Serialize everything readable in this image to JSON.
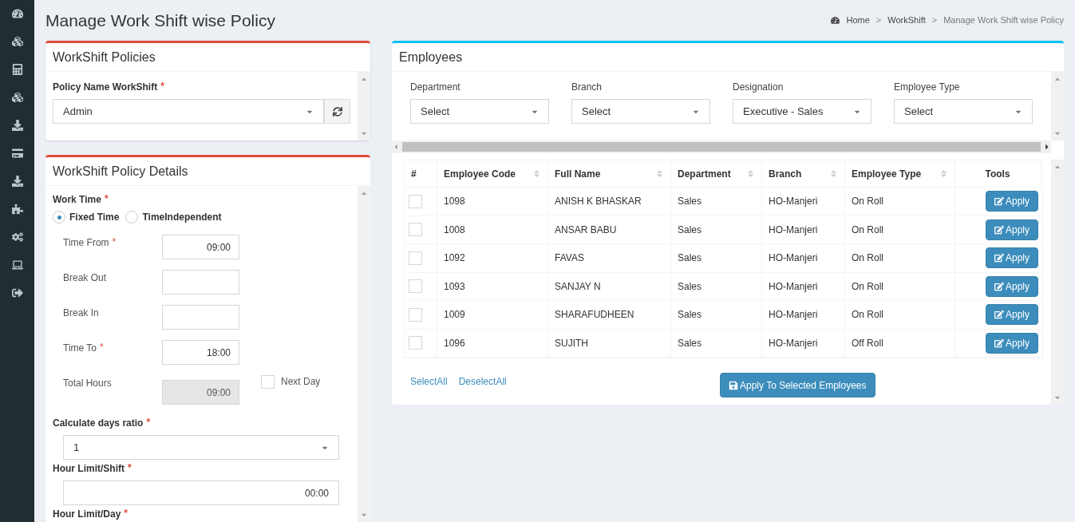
{
  "page_title": "Manage Work Shift wise Policy",
  "breadcrumb": [
    {
      "label": "Home",
      "separator": ">"
    },
    {
      "label": "WorkShift",
      "separator": ">"
    },
    {
      "label": "Manage Work Shift wise Policy"
    }
  ],
  "policies_panel": {
    "title": "WorkShift Policies",
    "field": {
      "label": "Policy Name WorkShift",
      "required_mark": "*",
      "value": "Admin"
    }
  },
  "details_panel": {
    "title": "WorkShift Policy Details",
    "work_time": {
      "label": "Work Time",
      "required_mark": "*",
      "options": [
        {
          "label": "Fixed Time",
          "selected": true
        },
        {
          "label": "TimeIndependent",
          "selected": false
        }
      ]
    },
    "time_fields": [
      {
        "label": "Time From",
        "required_mark": "*",
        "value": "09:00",
        "disabled": false
      },
      {
        "label": "Break Out",
        "disabled": false
      },
      {
        "label": "Break In",
        "disabled": false
      },
      {
        "label": "Time To",
        "required_mark": "*",
        "value": "18:00",
        "disabled": false
      },
      {
        "label": "Total Hours",
        "value": "09:00",
        "disabled": true
      }
    ],
    "next_day": {
      "label": "Next Day",
      "checked": false
    },
    "days_ratio": {
      "label": "Calculate days ratio",
      "required_mark": "*",
      "value": "1"
    },
    "hour_limit_shift": {
      "label": "Hour Limit/Shift",
      "required_mark": "*",
      "value": "00:00"
    },
    "hour_limit_day": {
      "label": "Hour Limit/Day",
      "required_mark": "*"
    }
  },
  "employees_panel": {
    "title": "Employees",
    "filters": [
      {
        "label": "Department",
        "value": "Select"
      },
      {
        "label": "Branch",
        "value": "Select"
      },
      {
        "label": "Designation",
        "value": "Executive - Sales"
      },
      {
        "label": "Employee Type",
        "value": "Select"
      }
    ],
    "table": {
      "columns": [
        {
          "label": "#",
          "sortable": false
        },
        {
          "label": "Employee Code",
          "sortable": true
        },
        {
          "label": "Full Name",
          "sortable": true
        },
        {
          "label": "Department",
          "sortable": true
        },
        {
          "label": "Branch",
          "sortable": true
        },
        {
          "label": "Employee Type",
          "sortable": true
        },
        {
          "label": "Tools",
          "sortable": false
        }
      ],
      "rows": [
        {
          "checked": false,
          "code": "1098",
          "name": "ANISH K BHASKAR",
          "department": "Sales",
          "branch": "HO-Manjeri",
          "type": "On Roll",
          "action": "Apply"
        },
        {
          "checked": false,
          "code": "1008",
          "name": "ANSAR BABU",
          "department": "Sales",
          "branch": "HO-Manjeri",
          "type": "On Roll",
          "action": "Apply"
        },
        {
          "checked": false,
          "code": "1092",
          "name": "FAVAS",
          "department": "Sales",
          "branch": "HO-Manjeri",
          "type": "On Roll",
          "action": "Apply"
        },
        {
          "checked": false,
          "code": "1093",
          "name": "SANJAY N",
          "department": "Sales",
          "branch": "HO-Manjeri",
          "type": "On Roll",
          "action": "Apply"
        },
        {
          "checked": false,
          "code": "1009",
          "name": "SHARAFUDHEEN",
          "department": "Sales",
          "branch": "HO-Manjeri",
          "type": "On Roll",
          "action": "Apply"
        },
        {
          "checked": false,
          "code": "1096",
          "name": "SUJITH",
          "department": "Sales",
          "branch": "HO-Manjeri",
          "type": "Off Roll",
          "action": "Apply"
        }
      ]
    },
    "links": [
      "SelectAll",
      "DeselectAll"
    ],
    "apply_all": "Apply To Selected Employees"
  }
}
